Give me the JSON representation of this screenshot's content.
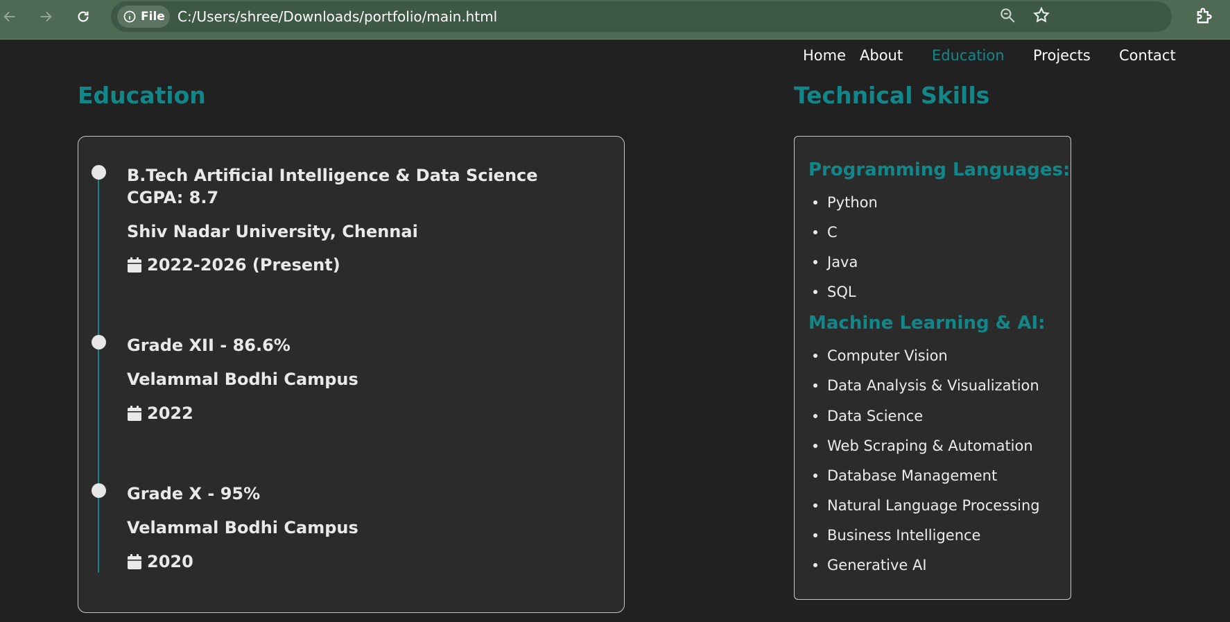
{
  "browser": {
    "chip_label": "File",
    "url": "C:/Users/shree/Downloads/portfolio/main.html",
    "icons": [
      "back-icon",
      "forward-icon",
      "reload-icon",
      "info-icon",
      "zoom-icon",
      "star-icon",
      "extensions-icon"
    ]
  },
  "nav": {
    "items": [
      {
        "label": "Home"
      },
      {
        "label": "About"
      },
      {
        "label": "Education",
        "active": true
      },
      {
        "label": "Projects"
      },
      {
        "label": "Contact"
      }
    ]
  },
  "education": {
    "title": "Education",
    "entries": [
      {
        "degree": "B.Tech Artificial Intelligence & Data Science",
        "score": "CGPA: 8.7",
        "institution": "Shiv Nadar University, Chennai",
        "years": "2022-2026 (Present)"
      },
      {
        "degree": "Grade XII - 86.6%",
        "institution": "Velammal Bodhi Campus",
        "years": "2022"
      },
      {
        "degree": "Grade X - 95%",
        "institution": "Velammal Bodhi Campus",
        "years": "2020"
      }
    ]
  },
  "skills": {
    "title": "Technical Skills",
    "groups": [
      {
        "heading": "Programming Languages:",
        "items": [
          "Python",
          "C",
          "Java",
          "SQL"
        ]
      },
      {
        "heading": "Machine Learning & AI:",
        "items": [
          "Computer Vision",
          "Data Analysis & Visualization",
          "Data Science",
          "Web Scraping & Automation",
          "Database Management",
          "Natural Language Processing",
          "Business Intelligence",
          "Generative AI"
        ]
      }
    ]
  },
  "colors": {
    "accent": "#12878a",
    "page_bg": "#212121",
    "card_bg": "#2b2b2b",
    "chrome_bg": "#4e6a55"
  }
}
